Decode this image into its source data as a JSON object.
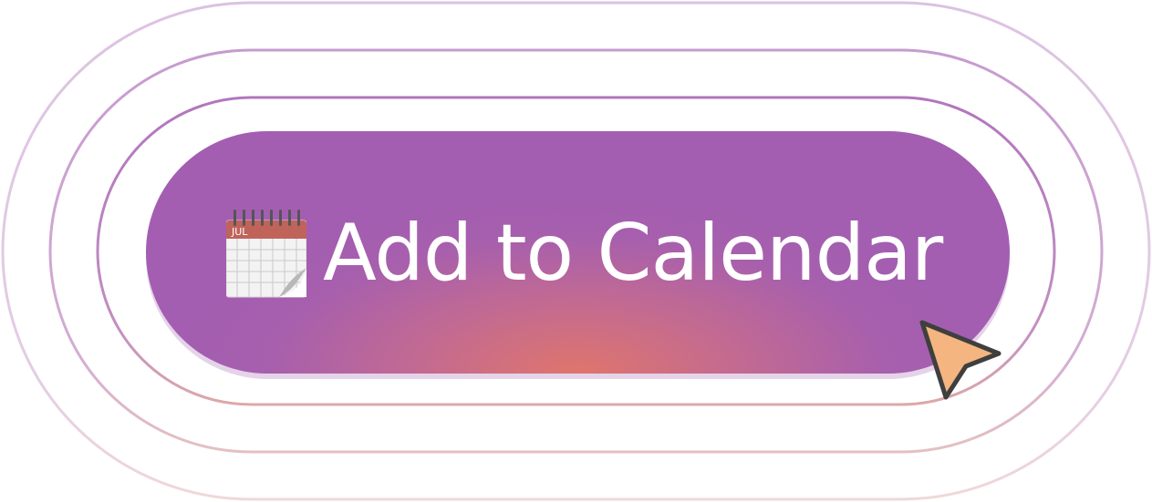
{
  "button": {
    "label": "Add to Calendar",
    "icon": "calendar-icon",
    "background_color": "#a35eb1",
    "glow_color": "#e27668",
    "text_color": "#ffffff"
  },
  "calendar_icon": {
    "month": "JUL"
  },
  "rings": {
    "color": "#a35eb1"
  },
  "cursor": {
    "icon": "pointer-arrow-icon",
    "fill_color": "#f4b580",
    "stroke_color": "#3f3f3f"
  }
}
